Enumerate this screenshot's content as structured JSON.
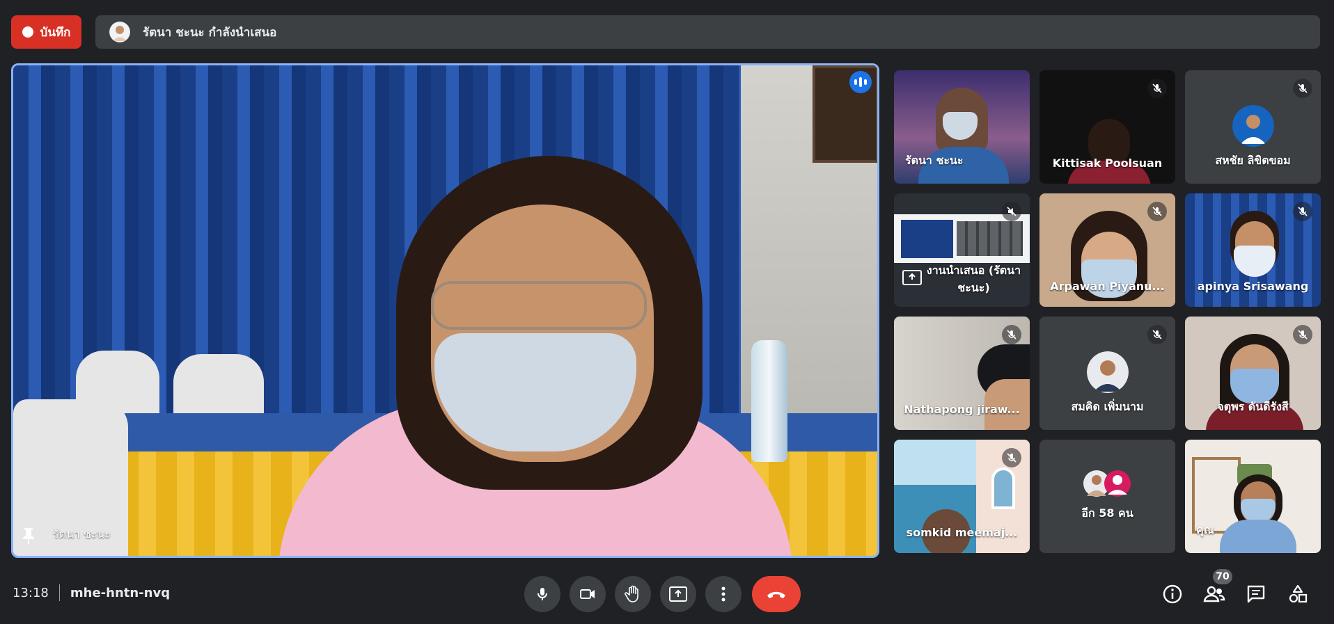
{
  "header": {
    "record_label": "บันทึก",
    "presenting_text": "รัตนา ชะนะ กำลังนำเสนอ"
  },
  "main_stage": {
    "speaker_name": "รัตนา ชะนะ"
  },
  "tiles": [
    {
      "name": "รัตนา ชะนะ"
    },
    {
      "name": "Kittisak Poolsuan"
    },
    {
      "name": "สหชัย ลิขิตขอม"
    },
    {
      "name": "งานนำเสนอ (รัตนา ชะนะ)"
    },
    {
      "name": "Arpawan Piyanu..."
    },
    {
      "name": "apinya Srisawang"
    },
    {
      "name": "Nathapong jiraw..."
    },
    {
      "name": "สมคิด เพิ่มนาม"
    },
    {
      "name": "จตุพร ดันดีรังสี"
    },
    {
      "name": "somkid meemaj..."
    },
    {
      "name": "อีก 58 คน"
    },
    {
      "name": "คุณ"
    }
  ],
  "footer": {
    "time": "13:18",
    "meeting_code": "mhe-hntn-nvq",
    "participant_count": "70"
  },
  "colors": {
    "accent": "#8ab4f8",
    "record": "#d93025",
    "end_call": "#ea4335",
    "surface": "#3c4043",
    "background": "#202124"
  },
  "icons": {
    "record": "record-dot-icon",
    "speaking": "audio-level-icon",
    "pin": "pin-icon",
    "mic_off": "mic-off-icon",
    "mic": "mic-icon",
    "camera": "camera-icon",
    "hand": "hand-icon",
    "present": "present-icon",
    "more": "more-icon",
    "end_call": "end-call-icon",
    "info": "info-icon",
    "people": "people-icon",
    "chat": "chat-icon",
    "activities": "activities-icon"
  }
}
